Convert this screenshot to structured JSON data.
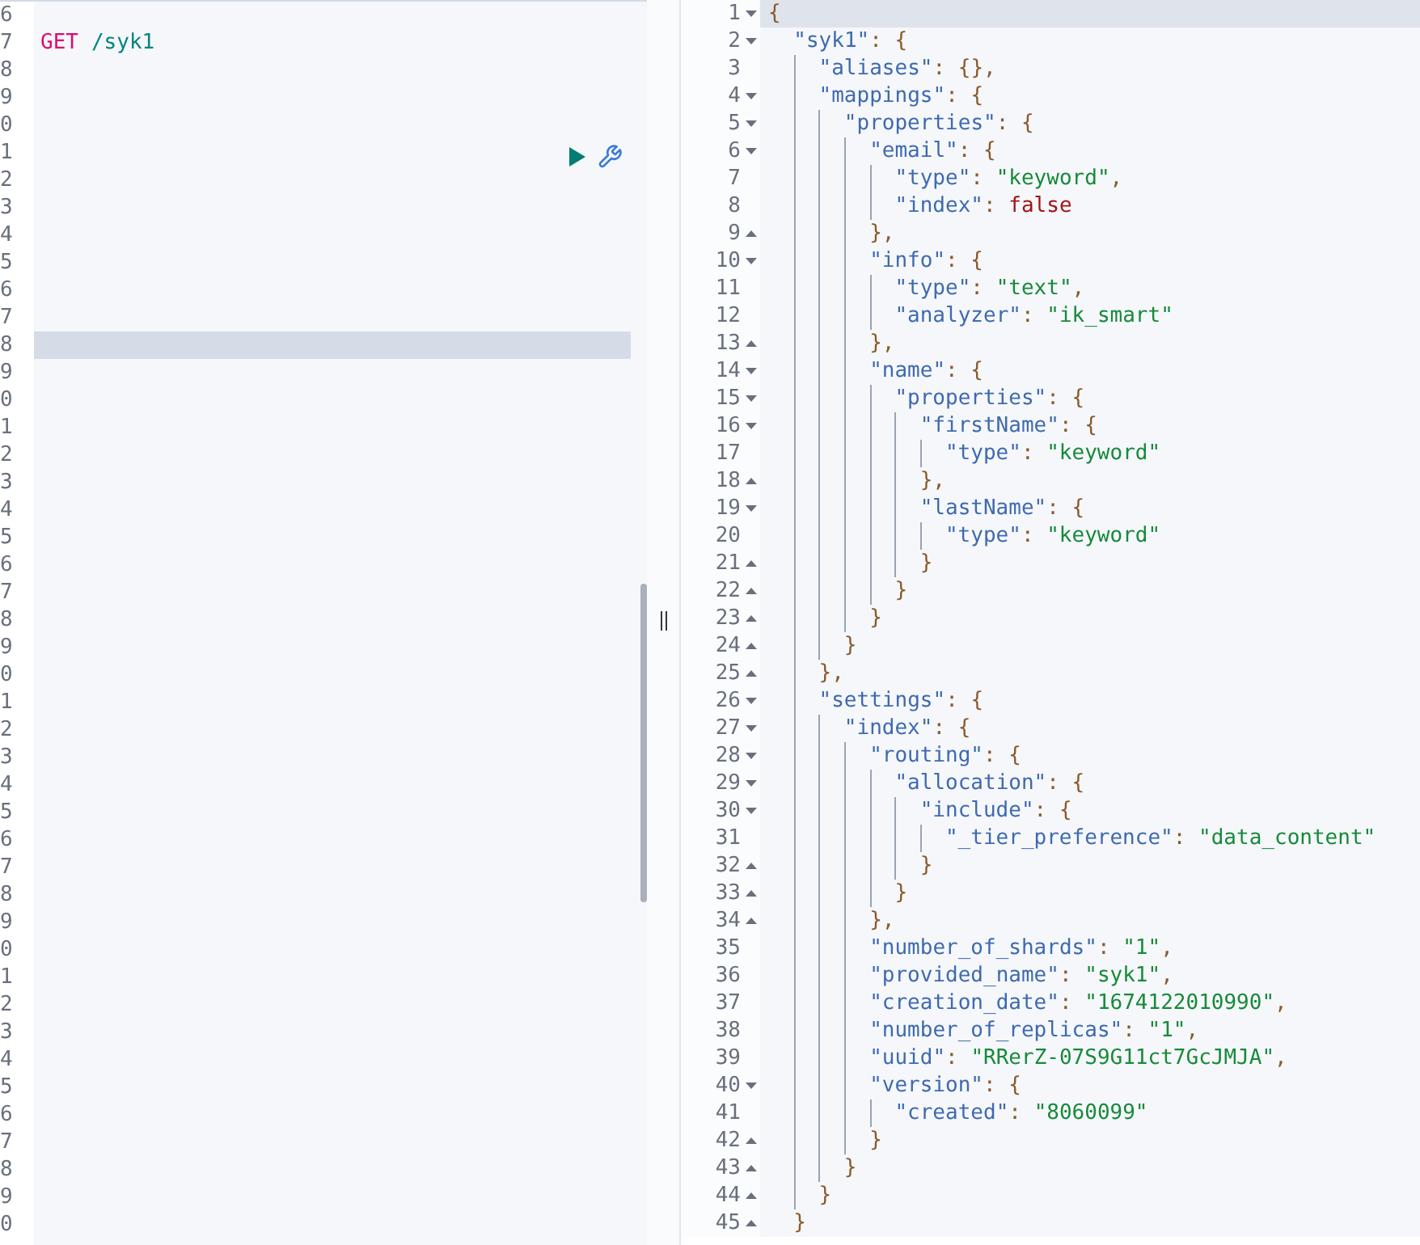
{
  "request_panel": {
    "lines": [
      {
        "number": "6",
        "active": false
      },
      {
        "number": "7",
        "active": false,
        "tokens": [
          {
            "kind": "method",
            "text": "GET"
          },
          {
            "kind": "path",
            "text": "/syk1"
          }
        ]
      },
      {
        "number": "8",
        "active": false
      },
      {
        "number": "9",
        "active": false
      },
      {
        "number": "0",
        "active": false
      },
      {
        "number": "1",
        "active": false
      },
      {
        "number": "2",
        "active": false
      },
      {
        "number": "3",
        "active": false
      },
      {
        "number": "4",
        "active": false
      },
      {
        "number": "5",
        "active": false
      },
      {
        "number": "6",
        "active": false
      },
      {
        "number": "7",
        "active": false
      },
      {
        "number": "8",
        "active": true
      },
      {
        "number": "9",
        "active": false
      },
      {
        "number": "0",
        "active": false
      },
      {
        "number": "1",
        "active": false
      },
      {
        "number": "2",
        "active": false
      },
      {
        "number": "3",
        "active": false
      },
      {
        "number": "4",
        "active": false
      },
      {
        "number": "5",
        "active": false
      },
      {
        "number": "6",
        "active": false
      },
      {
        "number": "7",
        "active": false
      },
      {
        "number": "8",
        "active": false
      },
      {
        "number": "9",
        "active": false
      },
      {
        "number": "0",
        "active": false
      },
      {
        "number": "1",
        "active": false
      },
      {
        "number": "2",
        "active": false
      },
      {
        "number": "3",
        "active": false
      },
      {
        "number": "4",
        "active": false
      },
      {
        "number": "5",
        "active": false
      },
      {
        "number": "6",
        "active": false
      },
      {
        "number": "7",
        "active": false
      },
      {
        "number": "8",
        "active": false
      },
      {
        "number": "9",
        "active": false
      },
      {
        "number": "0",
        "active": false
      },
      {
        "number": "1",
        "active": false
      },
      {
        "number": "2",
        "active": false
      },
      {
        "number": "3",
        "active": false
      },
      {
        "number": "4",
        "active": false
      },
      {
        "number": "5",
        "active": false
      },
      {
        "number": "6",
        "active": false
      },
      {
        "number": "7",
        "active": false
      },
      {
        "number": "8",
        "active": false
      },
      {
        "number": "9",
        "active": false
      },
      {
        "number": "0",
        "active": false
      }
    ]
  },
  "response_panel": {
    "lines": [
      {
        "number": "1",
        "expanded": true,
        "active": true,
        "code": "{"
      },
      {
        "number": "2",
        "expanded": true,
        "active": false,
        "code": "  \"syk1\": {"
      },
      {
        "number": "3",
        "active": false,
        "code": "    \"aliases\": {},"
      },
      {
        "number": "4",
        "expanded": true,
        "active": false,
        "code": "    \"mappings\": {"
      },
      {
        "number": "5",
        "expanded": true,
        "active": false,
        "code": "      \"properties\": {"
      },
      {
        "number": "6",
        "expanded": true,
        "active": false,
        "code": "        \"email\": {"
      },
      {
        "number": "7",
        "active": false,
        "code": "          \"type\": \"keyword\","
      },
      {
        "number": "8",
        "active": false,
        "code": "          \"index\": false"
      },
      {
        "number": "9",
        "expanded": false,
        "active": false,
        "code": "        },"
      },
      {
        "number": "10",
        "expanded": true,
        "active": false,
        "code": "        \"info\": {"
      },
      {
        "number": "11",
        "active": false,
        "code": "          \"type\": \"text\","
      },
      {
        "number": "12",
        "active": false,
        "code": "          \"analyzer\": \"ik_smart\""
      },
      {
        "number": "13",
        "expanded": false,
        "active": false,
        "code": "        },"
      },
      {
        "number": "14",
        "expanded": true,
        "active": false,
        "code": "        \"name\": {"
      },
      {
        "number": "15",
        "expanded": true,
        "active": false,
        "code": "          \"properties\": {"
      },
      {
        "number": "16",
        "expanded": true,
        "active": false,
        "code": "            \"firstName\": {"
      },
      {
        "number": "17",
        "active": false,
        "code": "              \"type\": \"keyword\""
      },
      {
        "number": "18",
        "expanded": false,
        "active": false,
        "code": "            },"
      },
      {
        "number": "19",
        "expanded": true,
        "active": false,
        "code": "            \"lastName\": {"
      },
      {
        "number": "20",
        "active": false,
        "code": "              \"type\": \"keyword\""
      },
      {
        "number": "21",
        "expanded": false,
        "active": false,
        "code": "            }"
      },
      {
        "number": "22",
        "expanded": false,
        "active": false,
        "code": "          }"
      },
      {
        "number": "23",
        "expanded": false,
        "active": false,
        "code": "        }"
      },
      {
        "number": "24",
        "expanded": false,
        "active": false,
        "code": "      }"
      },
      {
        "number": "25",
        "expanded": false,
        "active": false,
        "code": "    },"
      },
      {
        "number": "26",
        "expanded": true,
        "active": false,
        "code": "    \"settings\": {"
      },
      {
        "number": "27",
        "expanded": true,
        "active": false,
        "code": "      \"index\": {"
      },
      {
        "number": "28",
        "expanded": true,
        "active": false,
        "code": "        \"routing\": {"
      },
      {
        "number": "29",
        "expanded": true,
        "active": false,
        "code": "          \"allocation\": {"
      },
      {
        "number": "30",
        "expanded": true,
        "active": false,
        "code": "            \"include\": {"
      },
      {
        "number": "31",
        "active": false,
        "code": "              \"_tier_preference\": \"data_content\""
      },
      {
        "number": "32",
        "expanded": false,
        "active": false,
        "code": "            }"
      },
      {
        "number": "33",
        "expanded": false,
        "active": false,
        "code": "          }"
      },
      {
        "number": "34",
        "expanded": false,
        "active": false,
        "code": "        },"
      },
      {
        "number": "35",
        "active": false,
        "code": "        \"number_of_shards\": \"1\","
      },
      {
        "number": "36",
        "active": false,
        "code": "        \"provided_name\": \"syk1\","
      },
      {
        "number": "37",
        "active": false,
        "code": "        \"creation_date\": \"1674122010990\","
      },
      {
        "number": "38",
        "active": false,
        "code": "        \"number_of_replicas\": \"1\","
      },
      {
        "number": "39",
        "active": false,
        "code": "        \"uuid\": \"RRerZ-07S9G11ct7GcJMJA\","
      },
      {
        "number": "40",
        "expanded": true,
        "active": false,
        "code": "        \"version\": {"
      },
      {
        "number": "41",
        "active": false,
        "code": "          \"created\": \"8060099\""
      },
      {
        "number": "42",
        "expanded": false,
        "active": false,
        "code": "        }"
      },
      {
        "number": "43",
        "expanded": false,
        "active": false,
        "code": "      }"
      },
      {
        "number": "44",
        "expanded": false,
        "active": false,
        "code": "    }"
      },
      {
        "number": "45",
        "expanded": false,
        "active": false,
        "code": "  }"
      }
    ]
  }
}
